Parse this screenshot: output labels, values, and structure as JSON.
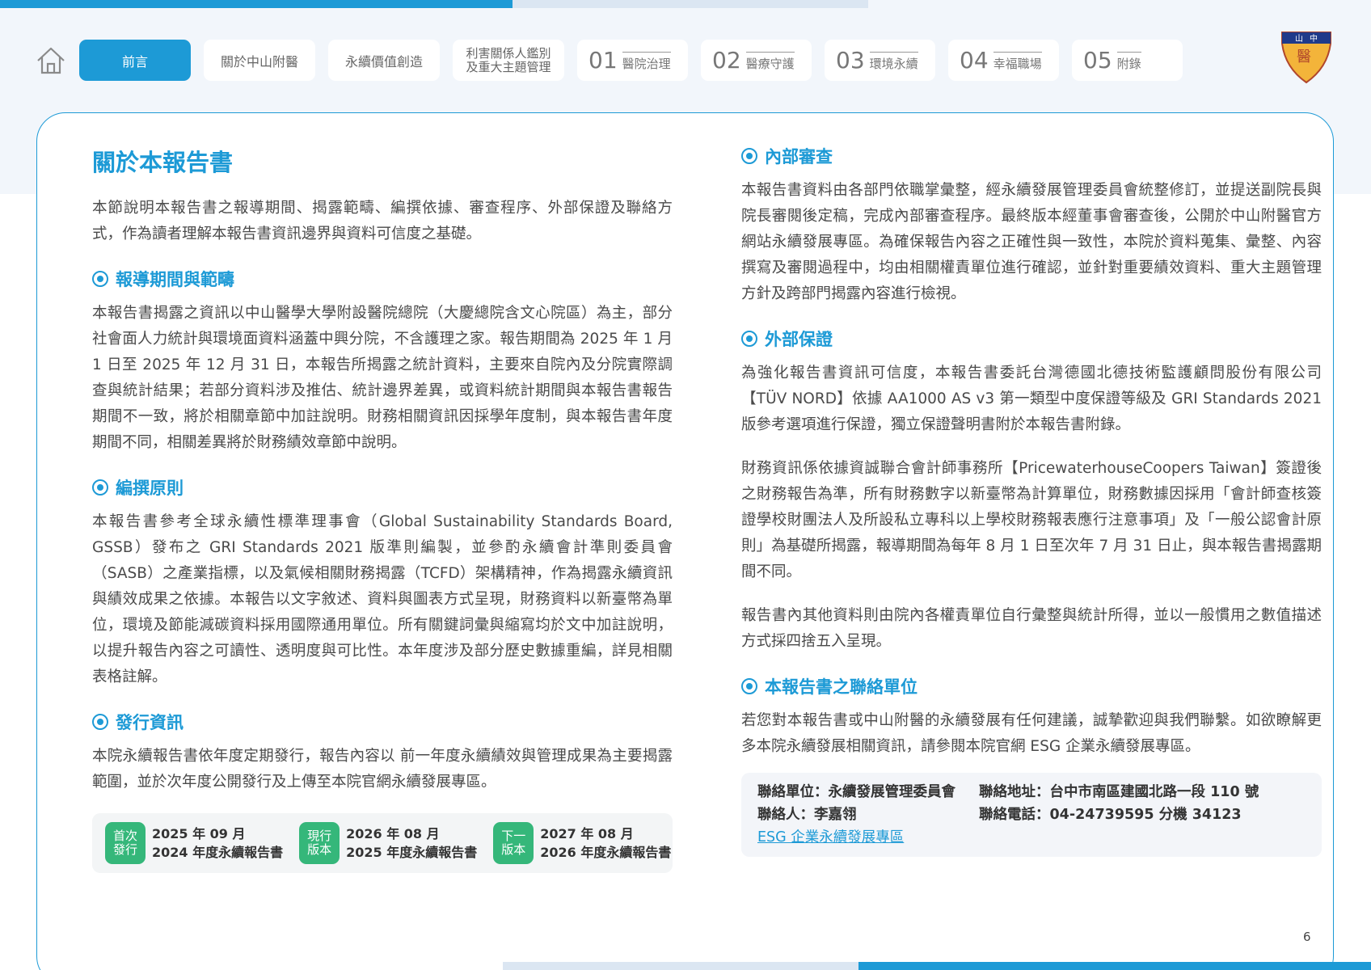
{
  "nav": {
    "tabs": [
      {
        "label": "前言",
        "active": true
      },
      {
        "label": "關於中山附醫"
      },
      {
        "label": "永續價值創造"
      },
      {
        "label_line1": "利害關係人鑑別",
        "label_line2": "及重大主題管理"
      },
      {
        "num": "01",
        "label": "醫院治理"
      },
      {
        "num": "02",
        "label": "醫療守護"
      },
      {
        "num": "03",
        "label": "環境永續"
      },
      {
        "num": "04",
        "label": "幸福職場"
      },
      {
        "num": "05",
        "label": "附錄"
      }
    ]
  },
  "logo": {
    "text": "山中醫"
  },
  "left": {
    "title": "關於本報告書",
    "intro": "本節說明本報告書之報導期間、揭露範疇、編撰依據、審查程序、外部保證及聯絡方式，作為讀者理解本報告書資訊邊界與資料可信度之基礎。",
    "sec1_title": "報導期間與範疇",
    "sec1_text": "本報告書揭露之資訊以中山醫學大學附設醫院總院（大慶總院含文心院區）為主，部分社會面人力統計與環境面資料涵蓋中興分院，不含護理之家。報告期間為 2025 年 1 月 1 日至 2025 年 12 月 31 日，本報告所揭露之統計資料，主要來自院內及分院實際調查與統計結果；若部分資料涉及推估、統計邊界差異，或資料統計期間與本報告書報告期間不一致，將於相關章節中加註說明。財務相關資訊因採學年度制，與本報告書年度期間不同，相關差異將於財務績效章節中說明。",
    "sec2_title": "編撰原則",
    "sec2_text": "本報告書參考全球永續性標準理事會（Global Sustainability Standards Board, GSSB）發布之 GRI Standards 2021 版準則編製，並參酌永續會計準則委員會（SASB）之產業指標，以及氣候相關財務揭露（TCFD）架構精神，作為揭露永續資訊與績效成果之依據。本報告以文字敘述、資料與圖表方式呈現，財務資料以新臺幣為單位，環境及節能減碳資料採用國際通用單位。所有關鍵詞彙與縮寫均於文中加註說明，以提升報告內容之可讀性、透明度與可比性。本年度涉及部分歷史數據重編，詳見相關表格註解。",
    "sec3_title": "發行資訊",
    "sec3_text": "本院永續報告書依年度定期發行，報告內容以 前一年度永續績效與管理成果為主要揭露範圍，並於次年度公開發行及上傳至本院官網永續發展專區。",
    "releases": [
      {
        "badge1": "首次",
        "badge2": "發行",
        "date": "2025 年 09 月",
        "name": "2024 年度永續報告書"
      },
      {
        "badge1": "現行",
        "badge2": "版本",
        "date": "2026 年 08 月",
        "name": "2025 年度永續報告書"
      },
      {
        "badge1": "下一",
        "badge2": "版本",
        "date": "2027 年 08 月",
        "name": "2026 年度永續報告書"
      }
    ]
  },
  "right": {
    "sec1_title": "內部審查",
    "sec1_text": "本報告書資料由各部門依職掌彙整，經永續發展管理委員會統整修訂，並提送副院長與院長審閱後定稿，完成內部審查程序。最終版本經董事會審查後，公開於中山附醫官方網站永續發展專區。為確保報告內容之正確性與一致性，本院於資料蒐集、彙整、內容撰寫及審閱過程中，均由相關權責單位進行確認，並針對重要績效資料、重大主題管理方針及跨部門揭露內容進行檢視。",
    "sec2_title": "外部保證",
    "sec2_text1": "為強化報告書資訊可信度，本報告書委託台灣德國北德技術監護顧問股份有限公司【TÜV NORD】依據 AA1000 AS v3 第一類型中度保證等級及 GRI Standards 2021 版參考選項進行保證，獨立保證聲明書附於本報告書附錄。",
    "sec2_text2": "財務資訊係依據資誠聯合會計師事務所【PricewaterhouseCoopers Taiwan】簽證後之財務報告為準，所有財務數字以新臺幣為計算單位，財務數據因採用「會計師查核簽證學校財團法人及所設私立專科以上學校財務報表應行注意事項」及「一般公認會計原 則」為基礎所揭露，報導期間為每年 8 月 1 日至次年 7 月 31 日止，與本報告書揭露期間不同。",
    "sec2_text3": "報告書內其他資料則由院內各權責單位自行彙整與統計所得，並以一般慣用之數值描述方式採四捨五入呈現。",
    "sec3_title": "本報告書之聯絡單位",
    "sec3_text": "若您對本報告書或中山附醫的永續發展有任何建議，誠摯歡迎與我們聯繫。如欲瞭解更多本院永續發展相關資訊，請參閱本院官網 ESG 企業永續發展專區。",
    "contact": {
      "unit": "聯絡單位：永續發展管理委員會",
      "address": "聯絡地址：台中市南區建國北路一段 110 號",
      "person": "聯絡人：李嘉翎",
      "phone": "聯絡電話：04-24739595 分機 34123",
      "link": "ESG 企業永續發展專區"
    }
  },
  "page_number": "6",
  "colors": {
    "accent": "#1d9ad6",
    "badge_green": "#35b77a"
  }
}
